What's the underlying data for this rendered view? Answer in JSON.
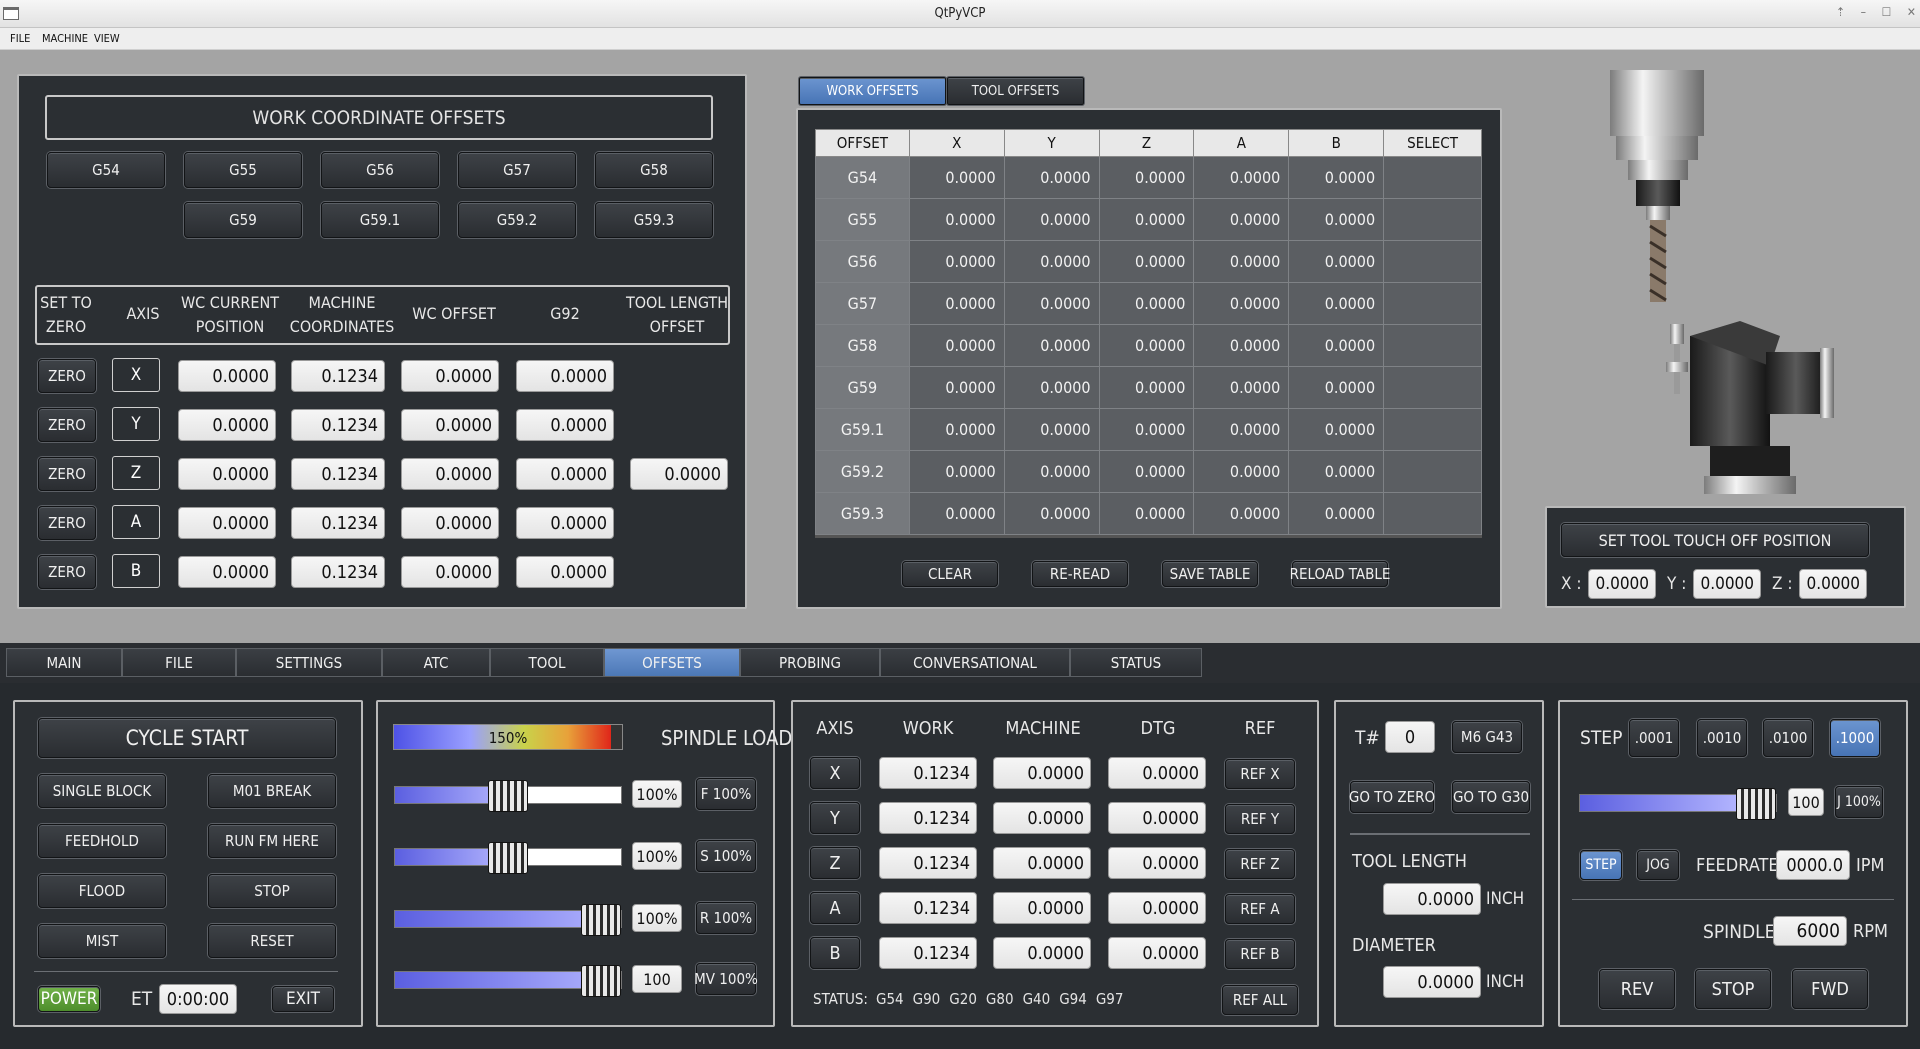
{
  "window": {
    "title": "QtPyVCP"
  },
  "menu": [
    "FILE",
    "MACHINE",
    "VIEW"
  ],
  "wco": {
    "title": "WORK COORDINATE OFFSETS",
    "row1": [
      "G54",
      "G55",
      "G56",
      "G57",
      "G58"
    ],
    "row2": [
      "G59",
      "G59.1",
      "G59.2",
      "G59.3"
    ],
    "headers": [
      "SET TO ZERO",
      "AXIS",
      "WC CURRENT POSITION",
      "MACHINE COORDINATES",
      "WC OFFSET",
      "G92",
      "TOOL LENGTH OFFSET"
    ],
    "zero_label": "ZERO",
    "rows": [
      {
        "axis": "X",
        "current": "0.0000",
        "machine": "0.1234",
        "offset": "0.0000",
        "g92": "0.0000"
      },
      {
        "axis": "Y",
        "current": "0.0000",
        "machine": "0.1234",
        "offset": "0.0000",
        "g92": "0.0000"
      },
      {
        "axis": "Z",
        "current": "0.0000",
        "machine": "0.1234",
        "offset": "0.0000",
        "g92": "0.0000",
        "tlo": "0.0000"
      },
      {
        "axis": "A",
        "current": "0.0000",
        "machine": "0.1234",
        "offset": "0.0000",
        "g92": "0.0000"
      },
      {
        "axis": "B",
        "current": "0.0000",
        "machine": "0.1234",
        "offset": "0.0000",
        "g92": "0.0000"
      }
    ]
  },
  "offsets_tabs": [
    "WORK OFFSETS",
    "TOOL OFFSETS"
  ],
  "offsets_table": {
    "columns": [
      "OFFSET",
      "X",
      "Y",
      "Z",
      "A",
      "B",
      "SELECT"
    ],
    "rows": [
      [
        "G54",
        "0.0000",
        "0.0000",
        "0.0000",
        "0.0000",
        "0.0000"
      ],
      [
        "G55",
        "0.0000",
        "0.0000",
        "0.0000",
        "0.0000",
        "0.0000"
      ],
      [
        "G56",
        "0.0000",
        "0.0000",
        "0.0000",
        "0.0000",
        "0.0000"
      ],
      [
        "G57",
        "0.0000",
        "0.0000",
        "0.0000",
        "0.0000",
        "0.0000"
      ],
      [
        "G58",
        "0.0000",
        "0.0000",
        "0.0000",
        "0.0000",
        "0.0000"
      ],
      [
        "G59",
        "0.0000",
        "0.0000",
        "0.0000",
        "0.0000",
        "0.0000"
      ],
      [
        "G59.1",
        "0.0000",
        "0.0000",
        "0.0000",
        "0.0000",
        "0.0000"
      ],
      [
        "G59.2",
        "0.0000",
        "0.0000",
        "0.0000",
        "0.0000",
        "0.0000"
      ],
      [
        "G59.3",
        "0.0000",
        "0.0000",
        "0.0000",
        "0.0000",
        "0.0000"
      ]
    ],
    "buttons": [
      "CLEAR",
      "RE-READ",
      "SAVE TABLE",
      "RELOAD TABLE"
    ]
  },
  "touchoff": {
    "title": "SET TOOL TOUCH OFF POSITION",
    "x_label": "X :",
    "y_label": "Y :",
    "z_label": "Z :",
    "x": "0.0000",
    "y": "0.0000",
    "z": "0.0000"
  },
  "main_tabs": [
    "MAIN",
    "FILE",
    "SETTINGS",
    "ATC",
    "TOOL",
    "OFFSETS",
    "PROBING",
    "CONVERSATIONAL",
    "STATUS"
  ],
  "main_tab_active": "OFFSETS",
  "controls": {
    "cycle_start": "CYCLE START",
    "buttons": [
      "SINGLE BLOCK",
      "M01 BREAK",
      "FEEDHOLD",
      "RUN FM HERE",
      "FLOOD",
      "STOP",
      "MIST",
      "RESET"
    ],
    "power": "POWER",
    "et_label": "ET",
    "et_value": "0:00:00",
    "exit": "EXIT"
  },
  "overrides": {
    "spindle_load_label": "SPINDLE LOAD",
    "spindle_load_value": "150%",
    "spindle_load_fraction": 0.95,
    "sliders": [
      {
        "value": "100%",
        "button": "F 100%",
        "fraction": 0.5
      },
      {
        "value": "100%",
        "button": "S 100%",
        "fraction": 0.5
      },
      {
        "value": "100%",
        "button": "R 100%",
        "fraction": 1.0
      },
      {
        "value": "100",
        "button": "MV 100%",
        "fraction": 1.0
      }
    ]
  },
  "dro": {
    "headers": [
      "AXIS",
      "WORK",
      "MACHINE",
      "DTG",
      "REF"
    ],
    "rows": [
      {
        "axis": "X",
        "work": "0.1234",
        "machine": "0.0000",
        "dtg": "0.0000",
        "ref": "REF X"
      },
      {
        "axis": "Y",
        "work": "0.1234",
        "machine": "0.0000",
        "dtg": "0.0000",
        "ref": "REF Y"
      },
      {
        "axis": "Z",
        "work": "0.1234",
        "machine": "0.0000",
        "dtg": "0.0000",
        "ref": "REF Z"
      },
      {
        "axis": "A",
        "work": "0.1234",
        "machine": "0.0000",
        "dtg": "0.0000",
        "ref": "REF A"
      },
      {
        "axis": "B",
        "work": "0.1234",
        "machine": "0.0000",
        "dtg": "0.0000",
        "ref": "REF B"
      }
    ],
    "status_label": "STATUS:",
    "gcodes": [
      "G54",
      "G90",
      "G20",
      "G80",
      "G40",
      "G94",
      "G97"
    ],
    "ref_all": "REF ALL"
  },
  "tool": {
    "t_label": "T#",
    "t_value": "0",
    "m6": "M6 G43",
    "goto_zero": "GO TO ZERO",
    "goto_g30": "GO TO G30",
    "length_label": "TOOL LENGTH",
    "length": "0.0000",
    "diameter_label": "DIAMETER",
    "diameter": "0.0000",
    "unit": "INCH"
  },
  "jog": {
    "step_label": "STEP",
    "steps": [
      ".0001",
      ".0010",
      ".0100",
      ".1000"
    ],
    "step_active": ".1000",
    "jog_value": "100",
    "jog_button": "J 100%",
    "jog_fraction": 0.8,
    "mode_step": "STEP",
    "mode_jog": "JOG",
    "feedrate_label": "FEEDRATE",
    "feedrate": "0000.0",
    "feed_unit": "IPM",
    "spindle_label": "SPINDLE",
    "spindle": "6000",
    "spindle_unit": "RPM",
    "rev": "REV",
    "stop": "STOP",
    "fwd": "FWD"
  },
  "colors": {
    "accent": "#5a85c4",
    "power": "#5e9e38",
    "panel": "#2b2f33",
    "background": "#a4a4a4"
  }
}
